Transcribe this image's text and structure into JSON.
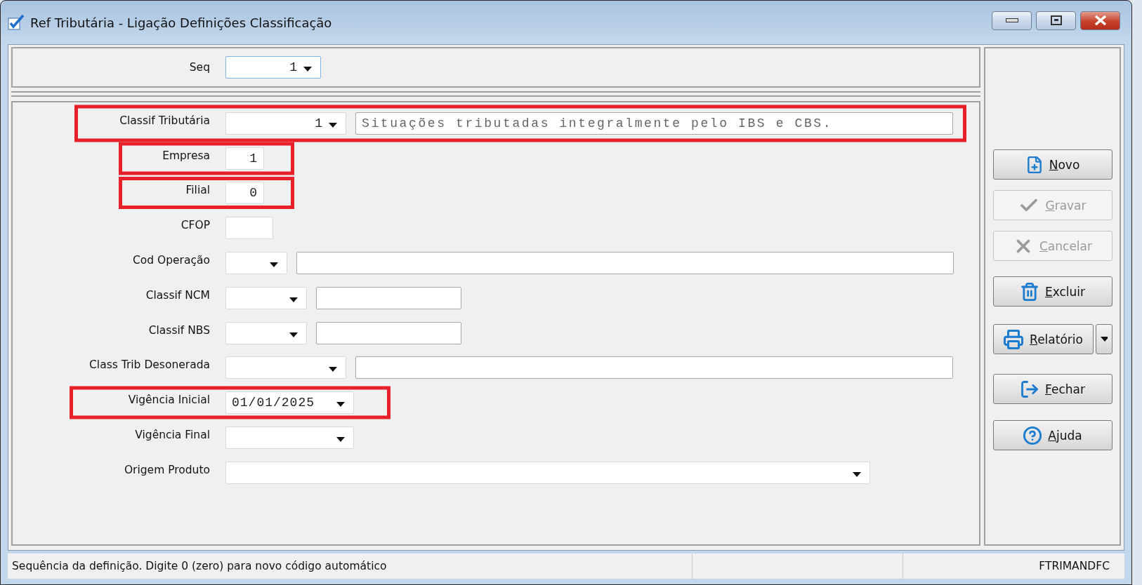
{
  "window": {
    "title": "Ref Tributária - Ligação Definições Classificação"
  },
  "seq": {
    "label": "Seq",
    "value": "1",
    "focused": true
  },
  "fields": [
    {
      "label": "Classif Tributária",
      "kind": "combo_with_text",
      "value": "1",
      "text": "Situações tributadas integralmente pelo IBS e CBS.",
      "highlighted": true
    },
    {
      "label": "Empresa",
      "kind": "text",
      "value": "1",
      "highlighted": true
    },
    {
      "label": "Filial",
      "kind": "text",
      "value": "0",
      "highlighted": true
    },
    {
      "label": "CFOP",
      "kind": "text",
      "highlighted": false
    },
    {
      "label": "Cod Operação",
      "kind": "combo_with_text",
      "highlighted": false
    },
    {
      "label": "Classif NCM",
      "kind": "combo_with_text",
      "highlighted": false
    },
    {
      "label": "Classif NBS",
      "kind": "combo_with_text",
      "highlighted": false
    },
    {
      "label": "Class Trib Desonerada",
      "kind": "combo_with_text",
      "highlighted": false
    },
    {
      "label": "Vigência Inicial",
      "kind": "combo",
      "value": "01/01/2025",
      "highlighted": true
    },
    {
      "label": "Vigência Final",
      "kind": "combo",
      "highlighted": false
    },
    {
      "label": "Origem Produto",
      "kind": "combo",
      "highlighted": false
    }
  ],
  "buttons": [
    {
      "label": "Novo",
      "disabled": false,
      "split": false
    },
    {
      "label": "Gravar",
      "disabled": true,
      "split": false
    },
    {
      "label": "Cancelar",
      "disabled": true,
      "split": false
    },
    {
      "label": "Excluir",
      "disabled": false,
      "split": false
    },
    {
      "label": "Relatório",
      "disabled": false,
      "split": true
    },
    {
      "label": "Fechar",
      "disabled": false,
      "split": false
    },
    {
      "label": "Ajuda",
      "disabled": false,
      "split": false
    }
  ],
  "status_bar": {
    "message": "Sequência da definição. Digite 0 (zero) para novo código automático",
    "form_code": "FTRIMANDFC"
  }
}
